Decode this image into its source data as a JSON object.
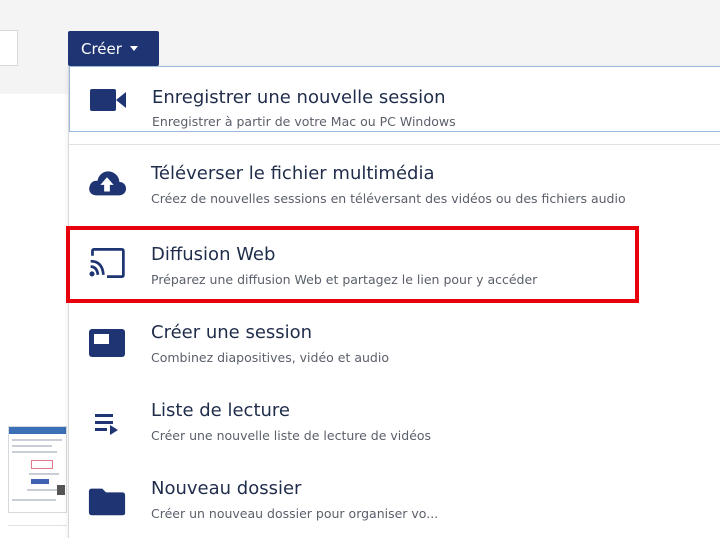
{
  "create_button": {
    "label": "Créer",
    "icon": "caret-down-icon"
  },
  "menu": {
    "items": [
      {
        "title": "Enregistrer une nouvelle session",
        "desc": "Enregistrer à partir de votre Mac ou PC Windows",
        "icon": "video-camera-icon"
      },
      {
        "title": "Téléverser le fichier multimédia",
        "desc": "Créez de nouvelles sessions en téléversant des vidéos ou des fichiers audio",
        "icon": "cloud-upload-icon"
      },
      {
        "title": "Diffusion Web",
        "desc": "Préparez une diffusion Web et partagez le lien pour y accéder",
        "icon": "cast-icon"
      },
      {
        "title": "Créer une session",
        "desc": "Combinez diapositives, vidéo et audio",
        "icon": "session-icon"
      },
      {
        "title": "Liste de lecture",
        "desc": "Créer une nouvelle liste de lecture de vidéos",
        "icon": "playlist-icon"
      },
      {
        "title": "Nouveau dossier",
        "desc": "Créer un nouveau dossier pour organiser vo...",
        "icon": "folder-icon"
      }
    ]
  },
  "colors": {
    "accent": "#1f3573",
    "highlight": "#e8000b",
    "focus_border": "#9bb9df"
  }
}
